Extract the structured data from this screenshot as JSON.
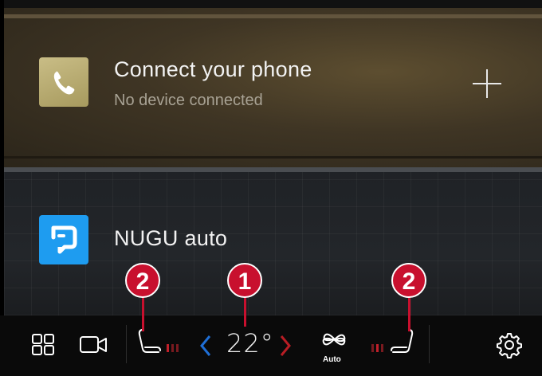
{
  "phone_card": {
    "title": "Connect your phone",
    "subtitle": "No device connected",
    "app_icon": "phone-icon",
    "action_icon": "plus-icon"
  },
  "nugu_card": {
    "title": "NUGU auto",
    "app_icon": "nugu-icon"
  },
  "climate_bar": {
    "temperature": "22°",
    "fan_mode": "Auto",
    "icons": [
      "app-grid-icon",
      "camera-icon",
      "driver-seat-icon",
      "seat-heat-level-icon",
      "temp-decrease-icon",
      "temp-increase-icon",
      "fan-icon",
      "passenger-seat-icon",
      "settings-icon"
    ]
  },
  "callouts": {
    "temperature_marker": "1",
    "left_seat_marker": "2",
    "right_seat_marker": "2"
  },
  "colors": {
    "callout_red": "#c8102e",
    "nugu_blue": "#1e9cf0",
    "phone_gold": "#b8ab6e",
    "temp_down_blue": "#1f6fd6",
    "temp_up_red": "#b81d24"
  }
}
